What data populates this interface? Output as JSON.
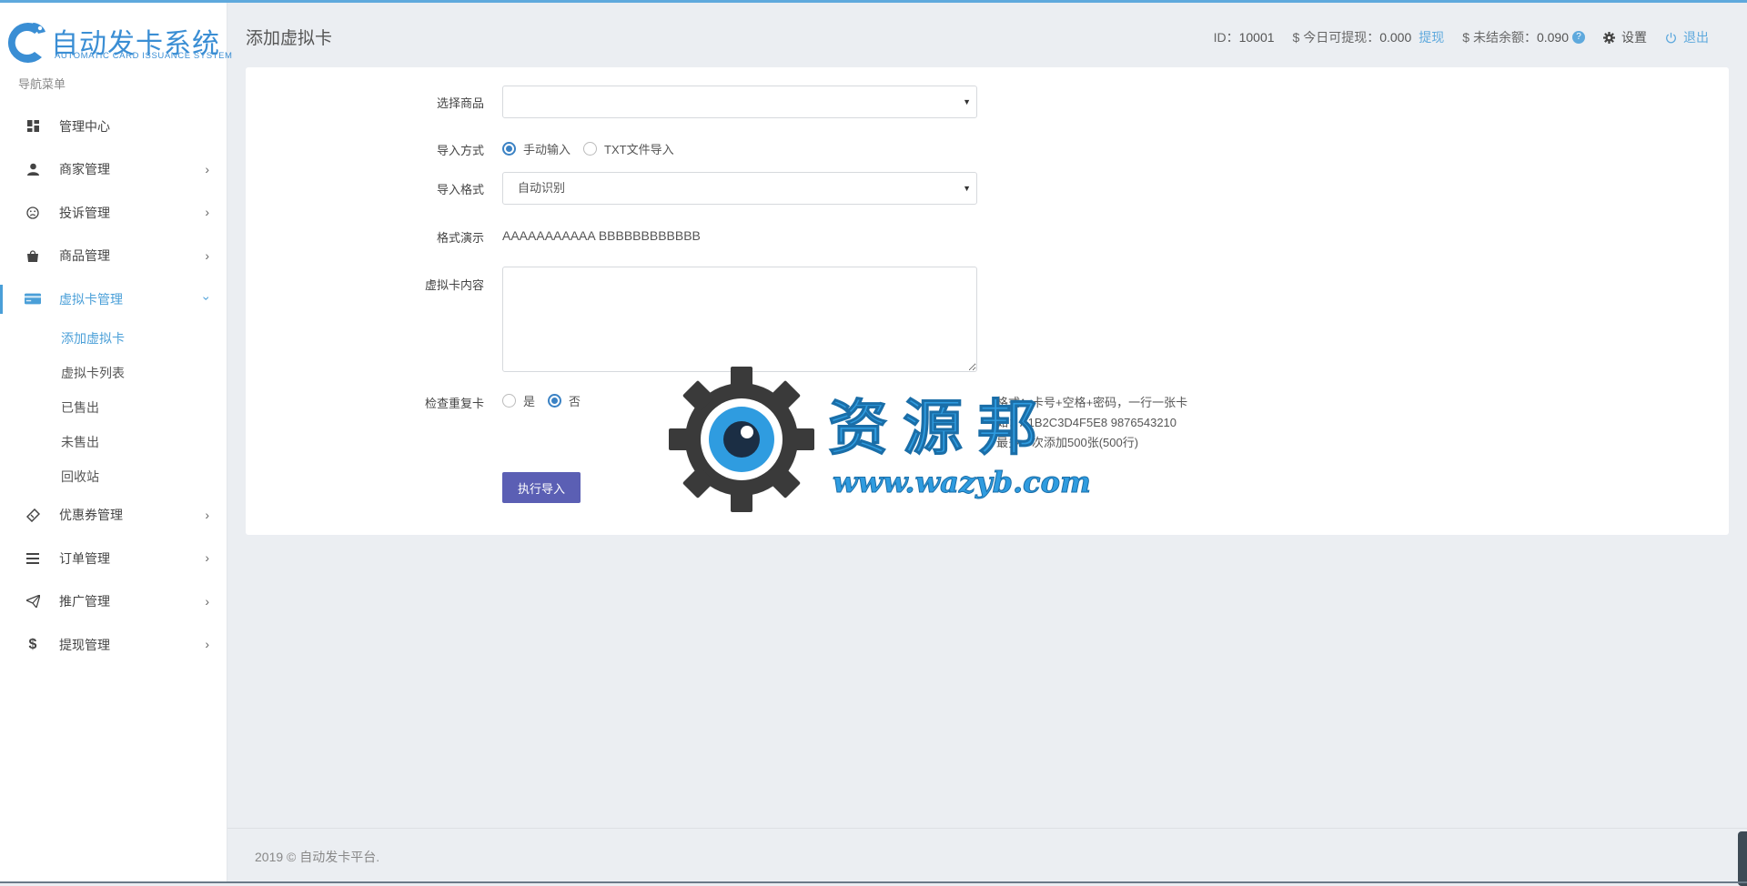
{
  "app": {
    "logo_cn": "自动发卡系统",
    "logo_en": "AUTOMATIC CARD ISSUANCE SYSTEM",
    "accent_color": "#4a9fd8"
  },
  "sidebar": {
    "heading": "导航菜单",
    "items": [
      {
        "label": "管理中心",
        "icon": "dashboard-icon"
      },
      {
        "label": "商家管理",
        "icon": "user-icon"
      },
      {
        "label": "投诉管理",
        "icon": "frown-icon"
      },
      {
        "label": "商品管理",
        "icon": "shopping-bag-icon"
      },
      {
        "label": "虚拟卡管理",
        "icon": "credit-card-icon",
        "active": true
      },
      {
        "label": "优惠券管理",
        "icon": "ticket-icon"
      },
      {
        "label": "订单管理",
        "icon": "list-icon"
      },
      {
        "label": "推广管理",
        "icon": "paper-plane-icon"
      },
      {
        "label": "提现管理",
        "icon": "dollar-icon"
      }
    ],
    "submenu": [
      {
        "label": "添加虚拟卡",
        "active": true
      },
      {
        "label": "虚拟卡列表"
      },
      {
        "label": "已售出"
      },
      {
        "label": "未售出"
      },
      {
        "label": "回收站"
      }
    ]
  },
  "header": {
    "title": "添加虚拟卡",
    "id_label": "ID：",
    "id_value": "10001",
    "today_label": "$ 今日可提现：",
    "today_value": "0.000",
    "withdraw_link": "提现",
    "balance_label": "$ 未结余额：",
    "balance_value": "0.090",
    "help": "?",
    "settings": "设置",
    "logout": "退出"
  },
  "form": {
    "product_label": "选择商品",
    "product_value": "",
    "import_method_label": "导入方式",
    "method_manual": "手动输入",
    "method_txt": "TXT文件导入",
    "import_format_label": "导入格式",
    "import_format_value": "自动识别",
    "demo_label": "格式演示",
    "demo_text": "AAAAAAAAAAA BBBBBBBBBBBB",
    "content_label": "虚拟卡内容",
    "content_value": "",
    "check_label": "检查重复卡",
    "check_yes": "是",
    "check_no": "否",
    "hint_lines": [
      "格式：卡号+空格+密码，一行一张卡",
      "如：A1B2C3D4F5E8 9876543210",
      "最多一次添加500张(500行)"
    ],
    "submit": "执行导入"
  },
  "watermark": {
    "cn": "资源邦",
    "url": "www.wazyb.com"
  },
  "footer": {
    "text": "2019 © 自动发卡平台."
  }
}
